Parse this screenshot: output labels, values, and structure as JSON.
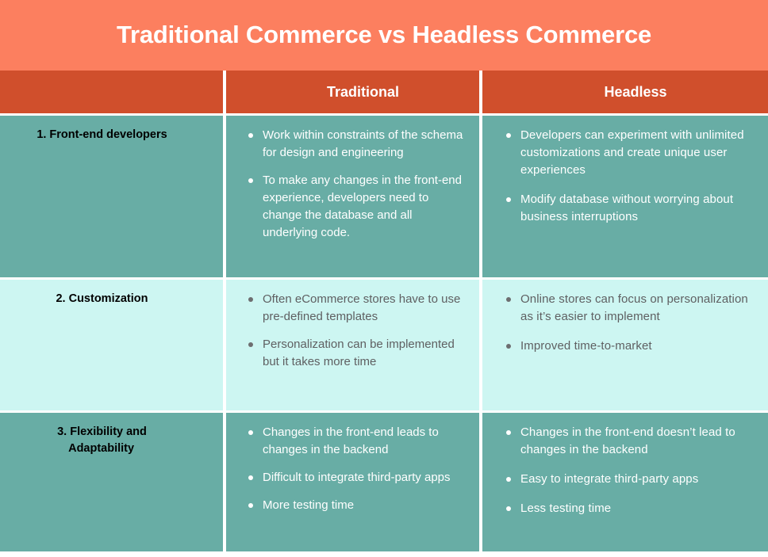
{
  "title": "Traditional Commerce vs Headless Commerce",
  "colors": {
    "title_band": "#fc7f5f",
    "header_row": "#d04f2c",
    "row_teal": "#68ada5",
    "row_cyan": "#cdf6f2",
    "text_light": "#ffffff",
    "text_dark": "#5f6062"
  },
  "table": {
    "headers": {
      "label": "",
      "traditional": "Traditional",
      "headless": "Headless"
    },
    "rows": [
      {
        "label": "1. Front-end developers",
        "tone": "teal",
        "traditional": [
          "Work within constraints of the schema for design and engineering",
          "To make any changes in the front-end experience, developers need to change the database and all underlying code."
        ],
        "headless": [
          "Developers can experiment with unlimited customizations and create unique user experiences",
          "Modify database without worrying about business interruptions"
        ]
      },
      {
        "label": "2. Customization",
        "tone": "cyan",
        "traditional": [
          "Often eCommerce stores have to use pre-defined templates",
          "Personalization can be implemented but it takes more time"
        ],
        "headless": [
          "Online stores can focus on personalization as it’s easier to implement",
          "Improved time-to-market"
        ]
      },
      {
        "label": "3. Flexibility and\nAdaptability",
        "tone": "teal",
        "traditional": [
          "Changes in the front-end leads to changes in the backend",
          "Difficult to integrate third-party apps",
          "More testing time"
        ],
        "headless": [
          "Changes in the front-end doesn’t lead to changes in the backend",
          "Easy to integrate third-party apps",
          "Less testing time"
        ]
      }
    ]
  }
}
